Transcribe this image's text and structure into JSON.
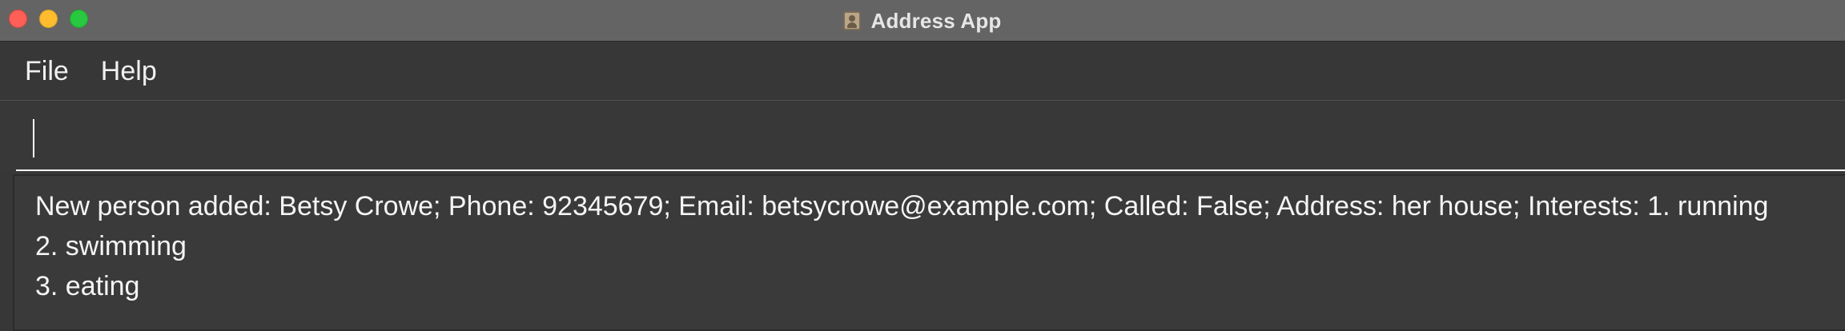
{
  "window": {
    "title": "Address App",
    "app_icon": "address-book-icon"
  },
  "menu": {
    "items": [
      {
        "label": "File"
      },
      {
        "label": "Help"
      }
    ]
  },
  "command_box": {
    "value": "",
    "placeholder": ""
  },
  "result_display": {
    "lines": [
      "New person added: Betsy Crowe; Phone: 92345679; Email: betsycrowe@example.com; Called: False; Address: her house; Interests: 1. running",
      "2. swimming",
      "3. eating"
    ]
  },
  "colors": {
    "titlebar": "#646464",
    "background": "#373737",
    "close": "#fe5f57",
    "minimize": "#febc2e",
    "maximize": "#28c840"
  }
}
